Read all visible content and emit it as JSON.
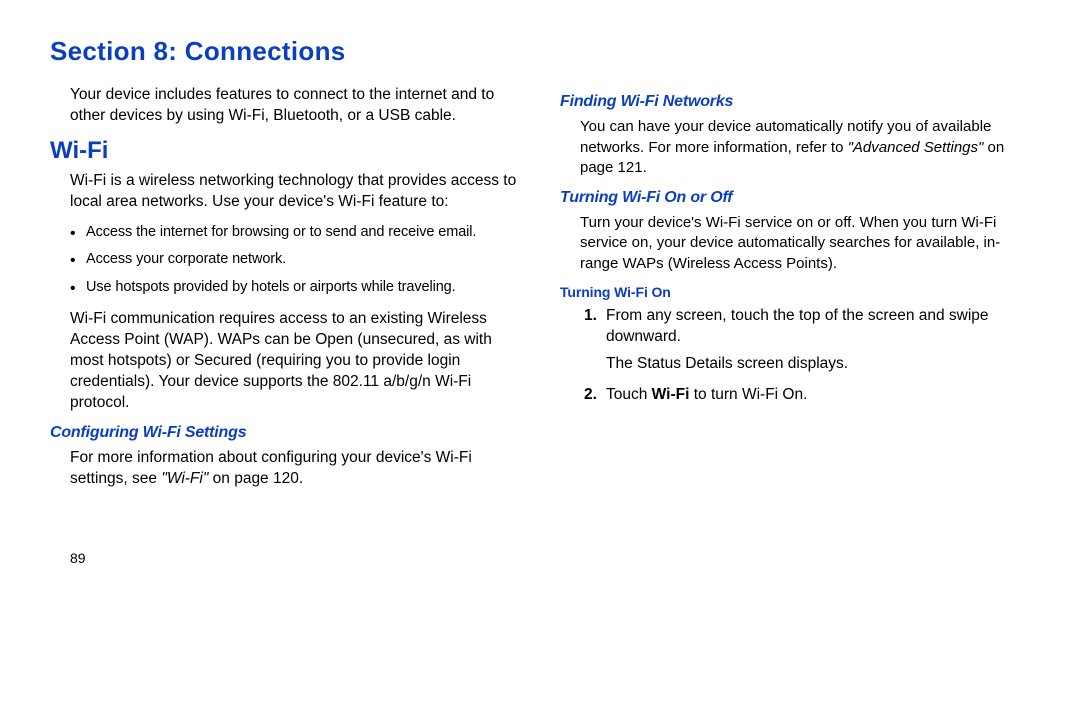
{
  "section_title": "Section 8: Connections",
  "left": {
    "intro": "Your device includes features to connect to the internet and to other devices by using Wi-Fi, Bluetooth, or a USB cable.",
    "wifi_heading": "Wi-Fi",
    "wifi_body1": "Wi-Fi is a wireless networking technology that provides access to local area networks. Use your device's Wi-Fi feature to:",
    "bullets": [
      "Access the internet for browsing or to send and receive email.",
      "Access your corporate network.",
      "Use hotspots provided by hotels or airports while traveling."
    ],
    "wifi_body2": "Wi-Fi communication requires access to an existing Wireless Access Point (WAP). WAPs can be Open (unsecured, as with most hotspots) or Secured (requiring you to provide login credentials). Your device supports the 802.11 a/b/g/n Wi-Fi protocol.",
    "configuring_heading": "Configuring Wi-Fi Settings",
    "configuring_body_pre": "For more information about configuring your device's Wi-Fi settings, see ",
    "configuring_ref": "\"Wi-Fi\"",
    "configuring_body_post": " on page 120."
  },
  "right": {
    "finding_heading": "Finding Wi-Fi Networks",
    "finding_body_pre": "You can have your device automatically notify you of available networks. For more information, refer to ",
    "finding_ref": "\"Advanced Settings\"",
    "finding_body_post": " on page 121.",
    "turning_heading": "Turning Wi-Fi On or Off",
    "turning_body": "Turn your device's Wi-Fi service on or off. When you turn Wi-Fi service on, your device automatically searches for available, in-range WAPs (Wireless Access Points).",
    "turning_on_heading": "Turning Wi-Fi On",
    "steps": [
      {
        "num": "1.",
        "text": "From any screen, touch the top of the screen and swipe downward.",
        "sub": "The Status Details screen displays."
      },
      {
        "num": "2.",
        "text_pre": "Touch ",
        "text_bold": "Wi-Fi",
        "text_post": " to turn Wi-Fi On."
      }
    ]
  },
  "page_number": "89"
}
